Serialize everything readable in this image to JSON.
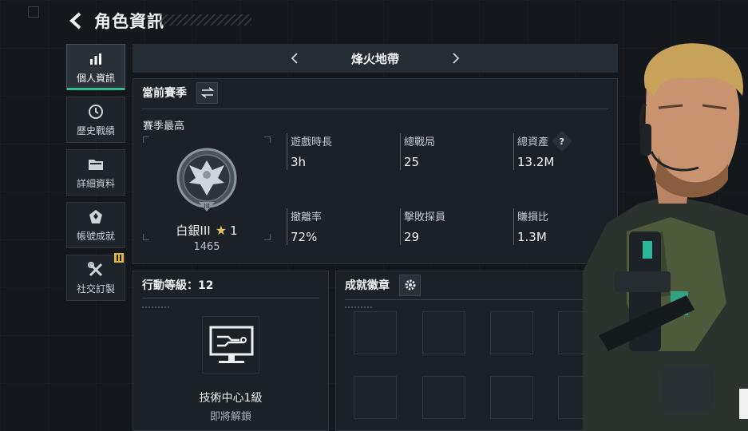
{
  "header": {
    "title": "角色資訊"
  },
  "sidebar": {
    "items": [
      {
        "label": "個人資訊",
        "icon": "bar-chart-icon",
        "active": true
      },
      {
        "label": "歷史戰績",
        "icon": "clock-icon",
        "active": false
      },
      {
        "label": "詳細資料",
        "icon": "folder-icon",
        "active": false
      },
      {
        "label": "帳號成就",
        "icon": "achievement-icon",
        "active": false
      },
      {
        "label": "社交訂製",
        "icon": "tools-icon",
        "active": false,
        "badge": true
      }
    ]
  },
  "mode": {
    "name": "烽火地帶"
  },
  "season": {
    "title": "當前賽季",
    "subtitle": "賽季最高",
    "rank": {
      "name": "白銀III",
      "stars": "1",
      "score": "1465"
    },
    "stats": [
      {
        "label": "遊戲時長",
        "value": "3h"
      },
      {
        "label": "總戰局",
        "value": "25"
      },
      {
        "label": "總資產",
        "value": "13.2M",
        "help": "?"
      },
      {
        "label": "撤離率",
        "value": "72%"
      },
      {
        "label": "擊敗探員",
        "value": "29"
      },
      {
        "label": "賺損比",
        "value": "1.3M"
      }
    ]
  },
  "level": {
    "title": "行動等級：12",
    "unlock_name": "技術中心1級",
    "unlock_status": "即將解鎖"
  },
  "achievements": {
    "title": "成就徽章"
  },
  "colors": {
    "accent": "#2fbf8f",
    "panel": "#1b2127",
    "background": "#14181d",
    "star": "#e6c25a",
    "badge": "#e0b840"
  }
}
